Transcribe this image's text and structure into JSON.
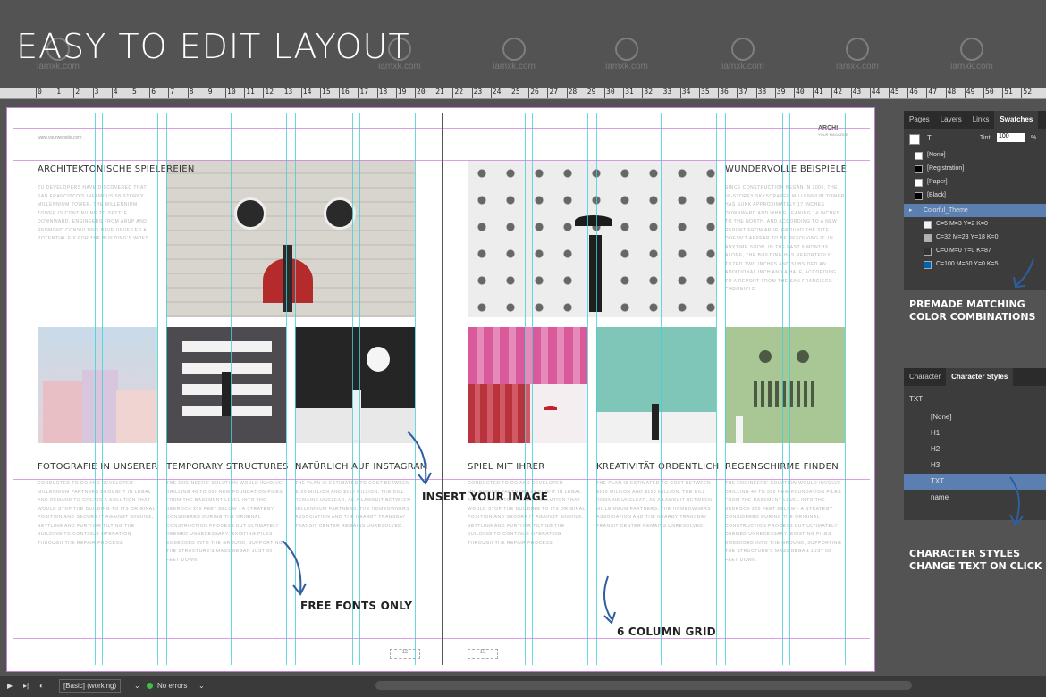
{
  "promo": {
    "title": "EASY TO EDIT LAYOUT",
    "watermark": "iamxk.com"
  },
  "ruler": {
    "ticks": [
      "0",
      "1",
      "2",
      "3",
      "4",
      "5",
      "6",
      "7",
      "8",
      "9",
      "10",
      "11",
      "12",
      "13",
      "14",
      "15",
      "16",
      "17",
      "18",
      "19",
      "20",
      "21",
      "22",
      "23",
      "24",
      "25",
      "26",
      "27",
      "28",
      "29",
      "30",
      "31",
      "32",
      "33",
      "34",
      "35",
      "36",
      "37",
      "38",
      "39",
      "40",
      "41",
      "42",
      "43",
      "44",
      "45",
      "46",
      "47",
      "48",
      "49",
      "50",
      "51",
      "52"
    ]
  },
  "left_page": {
    "header_small": "www.yourwebsite.com",
    "sections": [
      {
        "heading": "ARCHITEKTONISCHE SPIELEREIEN",
        "text": "ZU DEVELOPERS HAVE DISCOVERED THAT SAN FRANCISCO'S INFAMOUS 58-STOREY MILLENNIUM TOWER, THE MILLENNIUM TOWER IS CONTINUING TO SETTLE DOWNWARD. ENGINEERS FROM ARUP AND REDMOND CONSULTING HAVE UNVEILED A POTENTIAL FIX FOR THE BUILDING'S WOES."
      },
      {
        "heading": "FOTOGRAFIE IN UNSERER",
        "text": "CONDUCTED TO DO AND DEVELOPER MILLENNIUM PARTNERS BROUGHT IN LEGAL AND DEMAND TO CREATE A SOLUTION THAT WOULD STOP THE BUILDING TO ITS ORIGINAL POSITION AND SECURE IT AGAINST SINKING, SETTLING AND FURTHER TILTING THE BUILDING TO CONTINUE OPERATION THROUGH THE REPAIR PROCESS."
      },
      {
        "heading": "TEMPORARY STRUCTURES",
        "text": "THE ENGINEERS' SOLUTION WOULD INVOLVE DRILLING 40 TO 300 NEW FOUNDATION PILES FROM THE BASEMENT LEVEL INTO THE BEDROCK 200 FEET BELOW - A STRATEGY CONSIDERED DURING THE ORIGINAL CONSTRUCTION PROCESS BUT ULTIMATELY DEEMED UNNECESSARY. EXISTING PILES EMBEDDED INTO THE GROUND, SUPPORTING THE STRUCTURE'S MASS BEGAN JUST 60 FEET DOWN."
      },
      {
        "heading": "NATÜRLICH AUF INSTAGRAM",
        "text": "THE PLAN IS ESTIMATED TO COST BETWEEN $100 MILLION AND $150 MILLION. THE BILL REMAINS UNCLEAR, AS A LAWSUIT BETWEEN MILLENNIUM PARTNERS, THE HOMEOWNERS ASSOCIATION AND THE NEARBY TRANSBAY TRANSIT CENTER REMAINS UNRESOLVED."
      }
    ]
  },
  "right_page": {
    "header_small": "ARCHI",
    "header_small2": "YOUR MAGAZINE",
    "sections": [
      {
        "heading": "WUNDERVOLLE BEISPIELE",
        "text": "SINCE CONSTRUCTION BEGAN IN 2005, THE 58-STOREY SKYSCRAPER MILLENNIUM TOWER HAS SUNK APPROXIMATELY 17 INCHES DOWNWARD AND WHILE LEANING 14 INCHES TO THE NORTH, AND ACCORDING TO A NEW REPORT FROM ARUP, GROUND THE SITE DOESN'T APPEAR TO BE RESOLVING IT. IN ANYTIME SOON. IN THE PAST 9 MONTHS ALONE, THE BUILDING HAS REPORTEDLY TILTED TWO INCHES AND SUBSIDED AN ADDITIONAL INCH AND A HALF, ACCORDING TO A REPORT FROM THE SAN FRANCISCO CHRONICLE."
      },
      {
        "heading": "SPIEL MIT IHRER",
        "text": "CONDUCTED TO DO AND DEVELOPER MILLENNIUM PARTNERS BROUGHT IN LEGAL AND DEMAND TO CREATE A SOLUTION THAT WOULD STOP THE BUILDING TO ITS ORIGINAL POSITION AND SECURE IT AGAINST SINKING, SETTLING AND FURTHER TILTING THE BUILDING TO CONTINUE OPERATING THROUGH THE REPAIR PROCESS."
      },
      {
        "heading": "KREATIVITÄT ORDENTLICH",
        "text": "THE PLAN IS ESTIMATED TO COST BETWEEN $100 MILLION AND $150 MILLION. THE BILL REMAINS UNCLEAR, AS A LAWSUIT BETWEEN MILLENNIUM PARTNERS, THE HOMEOWNERS ASSOCIATION AND THE NEARBY TRANSBAY TRANSIT CENTER REMAINS UNRESOLVED."
      },
      {
        "heading": "REGENSCHIRME FINDEN",
        "text": "THE ENGINEERS' SOLUTION WOULD INVOLVE DRILLING 40 TO 300 NEW FOUNDATION PILES FROM THE BASEMENT LEVEL INTO THE BEDROCK 200 FEET BELOW - A STRATEGY CONSIDERED DURING THE ORIGINAL CONSTRUCTION PROCESS BUT ULTIMATELY DEEMED UNNECESSARY. EXISTING PILES EMBEDDED INTO THE GROUND, SUPPORTING THE STRUCTURE'S MASS BEGAN JUST 60 FEET DOWN."
      }
    ]
  },
  "annotations": {
    "insert_image": "INSERT YOUR IMAGE",
    "free_fonts": "FREE FONTS ONLY",
    "column_grid": "6 COLUMN GRID",
    "premade_colors_1": "PREMADE MATCHING",
    "premade_colors_2": "COLOR COMBINATIONS",
    "char_styles_1": "CHARACTER STYLES",
    "char_styles_2": "CHANGE TEXT ON CLICK"
  },
  "swatches_panel": {
    "tabs": [
      "Pages",
      "Layers",
      "Links",
      "Swatches"
    ],
    "tint_label": "Tint:",
    "tint_value": "100",
    "tint_unit": "%",
    "items": [
      {
        "label": "[None]",
        "color": "#ffffff"
      },
      {
        "label": "[Registration]",
        "color": "#000000"
      },
      {
        "label": "[Paper]",
        "color": "#ffffff"
      },
      {
        "label": "[Black]",
        "color": "#000000"
      }
    ],
    "group_label": "Colorful_Theme",
    "group_items": [
      {
        "label": "C=5 M=3 Y=2 K=0",
        "color": "#f2f3f5"
      },
      {
        "label": "C=32 M=23 Y=18 K=0",
        "color": "#adb4ba"
      },
      {
        "label": "C=0 M=0 Y=0 K=87",
        "color": "#333333"
      },
      {
        "label": "C=100 M=50 Y=0 K=5",
        "color": "#0063b0"
      }
    ]
  },
  "char_styles_panel": {
    "tabs": [
      "Character",
      "Character Styles"
    ],
    "current": "TXT",
    "items": [
      "[None]",
      "H1",
      "H2",
      "H3",
      "TXT",
      "name"
    ],
    "selected": "TXT"
  },
  "status_bar": {
    "profile": "[Basic] (working)",
    "errors": "No errors"
  },
  "page_numbers": {
    "left": "12",
    "right": "13"
  },
  "colors": {
    "guide_cyan": "#41d0d8",
    "guide_magenta": "#c77bd6",
    "arrow_blue": "#2d5fa1",
    "selected_row": "#5b7fb0"
  }
}
